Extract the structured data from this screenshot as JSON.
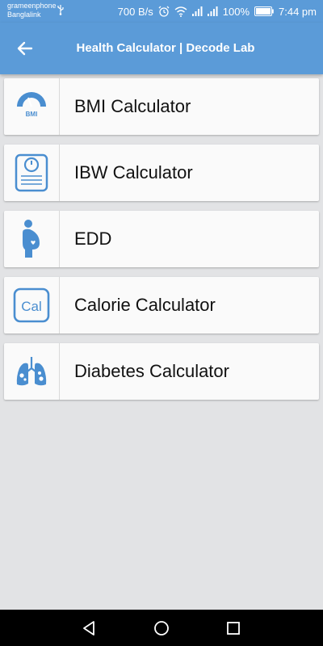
{
  "status_bar": {
    "carrier_1": "grameenphone",
    "carrier_2": "Banglalink",
    "speed": "700 B/s",
    "battery": "100%",
    "time": "7:44 pm"
  },
  "app_bar": {
    "title": "Health Calculator | Decode Lab"
  },
  "menu": [
    {
      "label": "BMI Calculator",
      "icon": "bmi-gauge-icon",
      "icon_text": "BMI"
    },
    {
      "label": "IBW Calculator",
      "icon": "weighing-scale-icon"
    },
    {
      "label": "EDD",
      "icon": "pregnant-woman-icon"
    },
    {
      "label": "Calorie Calculator",
      "icon": "calorie-icon",
      "icon_text": "Cal"
    },
    {
      "label": "Diabetes Calculator",
      "icon": "lungs-icon"
    }
  ],
  "colors": {
    "primary": "#5b9bd8",
    "icon": "#4a8ed0",
    "background": "#e2e3e5"
  }
}
